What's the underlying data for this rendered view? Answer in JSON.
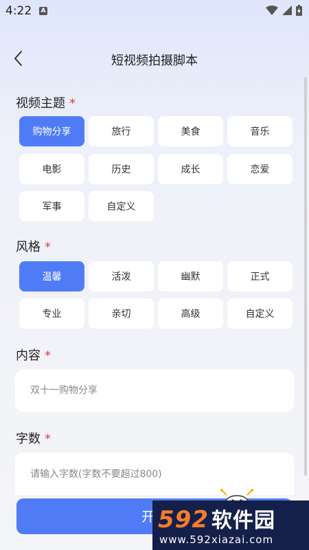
{
  "status_bar": {
    "time": "4:22",
    "notification_label": "A"
  },
  "header": {
    "title": "短视频拍摄脚本"
  },
  "sections": {
    "topic": {
      "title": "视频主题",
      "required_mark": "*",
      "options": [
        "购物分享",
        "旅行",
        "美食",
        "音乐",
        "电影",
        "历史",
        "成长",
        "恋爱",
        "军事",
        "自定义"
      ],
      "selected": "购物分享"
    },
    "style": {
      "title": "风格",
      "required_mark": "*",
      "options": [
        "温馨",
        "活泼",
        "幽默",
        "正式",
        "专业",
        "亲切",
        "高级",
        "自定义"
      ],
      "selected": "温馨"
    },
    "content": {
      "title": "内容",
      "required_mark": "*",
      "value": "双十一购物分享"
    },
    "word_count": {
      "title": "字数",
      "required_mark": "*",
      "placeholder": "请输入字数(字数不要超过800)"
    }
  },
  "start_button": {
    "label": "开始"
  },
  "watermark": {
    "logo_num": "592",
    "logo_text": "软件园",
    "url": "www.592xiazai.com"
  },
  "colors": {
    "accent": "#4f7cf6",
    "required": "#e0453b"
  }
}
